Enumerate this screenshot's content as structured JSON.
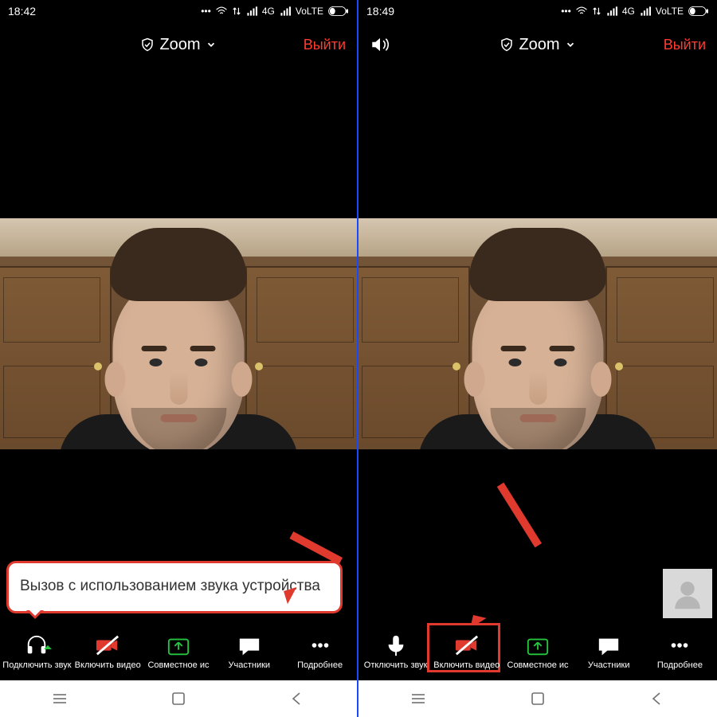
{
  "left": {
    "status_time": "18:42",
    "status_net": "4G",
    "status_volte": "VoLTE",
    "top_center": "Zoom",
    "leave": "Выйти",
    "bubble_text": "Вызов с использованием звука устройства",
    "toolbar": {
      "audio": "Подключить звук",
      "video": "Включить видео",
      "share": "Совместное ис",
      "participants": "Участники",
      "more": "Подробнее"
    }
  },
  "right": {
    "status_time": "18:49",
    "status_net": "4G",
    "status_volte": "VoLTE",
    "top_center": "Zoom",
    "leave": "Выйти",
    "toolbar": {
      "audio": "Отключить звук",
      "video": "Включить видео",
      "share": "Совместное ис",
      "participants": "Участники",
      "more": "Подробнее"
    }
  },
  "colors": {
    "accent_red": "#e03a2f",
    "accent_green": "#25c53f"
  }
}
